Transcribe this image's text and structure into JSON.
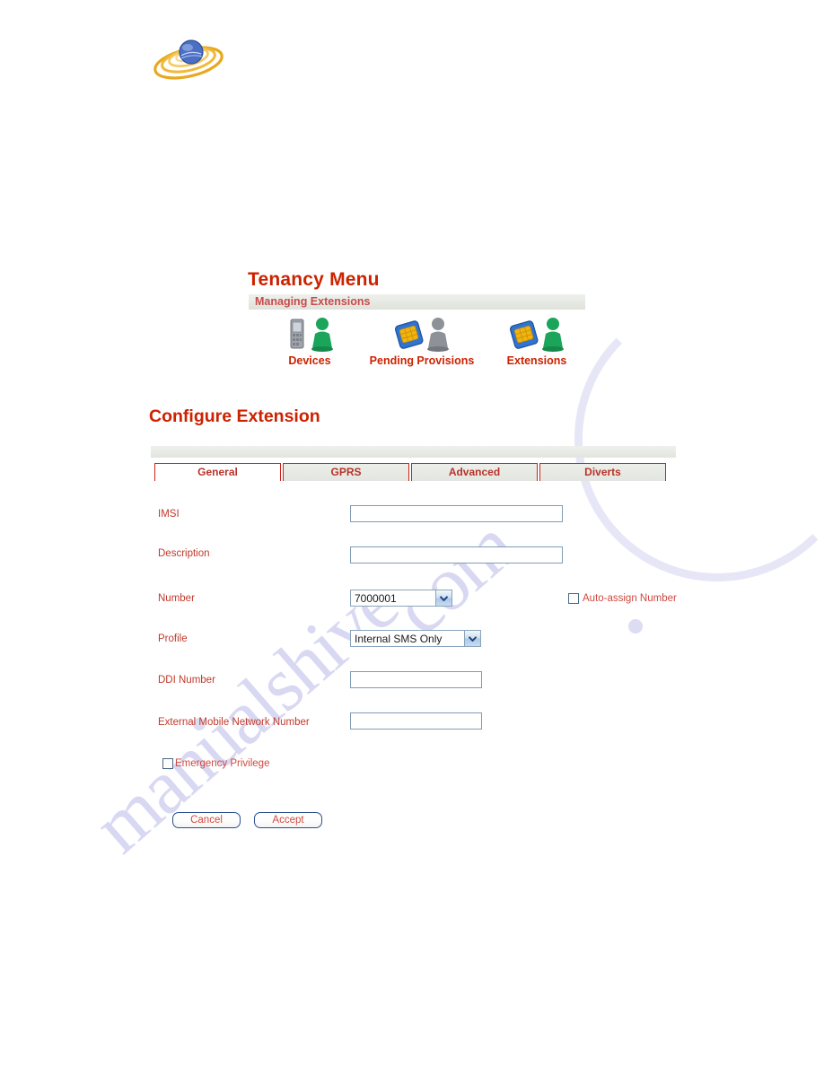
{
  "logo": {
    "icon": "orbit-sphere-logo"
  },
  "tenancy": {
    "title": "Tenancy Menu",
    "section_bar_label": "Managing Extensions",
    "menu_items": [
      {
        "label": "Devices",
        "icon": "phone-and-person-icon"
      },
      {
        "label": "Pending Provisions",
        "icon": "sim-card-and-gray-person-icon"
      },
      {
        "label": "Extensions",
        "icon": "sim-card-and-green-person-icon"
      }
    ]
  },
  "page": {
    "title": "Configure Extension"
  },
  "tabs": [
    {
      "label": "General",
      "active": true
    },
    {
      "label": "GPRS",
      "active": false
    },
    {
      "label": "Advanced",
      "active": false
    },
    {
      "label": "Diverts",
      "active": false
    }
  ],
  "form": {
    "fields": {
      "imsi": {
        "label": "IMSI",
        "value": "",
        "placeholder": ""
      },
      "description": {
        "label": "Description",
        "value": "",
        "placeholder": ""
      },
      "number": {
        "label": "Number",
        "value": "7000001"
      },
      "profile": {
        "label": "Profile",
        "value": "Internal SMS Only"
      },
      "ddi_number": {
        "label": "DDI Number",
        "value": "",
        "placeholder": ""
      },
      "external_mobile_network_number": {
        "label": "External Mobile Network Number",
        "value": "",
        "placeholder": ""
      }
    },
    "checkboxes": {
      "auto_assign_number": {
        "label": "Auto-assign Number",
        "checked": false
      },
      "emergency_privilege": {
        "label": "Emergency Privilege",
        "checked": false
      }
    }
  },
  "buttons": {
    "cancel": "Cancel",
    "accept": "Accept"
  },
  "watermark": {
    "line_a": "manualshive",
    "line_b": ".com"
  },
  "colors": {
    "heading_red": "#cc2200",
    "label_red": "#c0392b",
    "tab_border": "#c8261b",
    "input_border": "#7f9cb5",
    "button_border": "#2b4f8e",
    "bar_gray": "#e6e9e3"
  }
}
